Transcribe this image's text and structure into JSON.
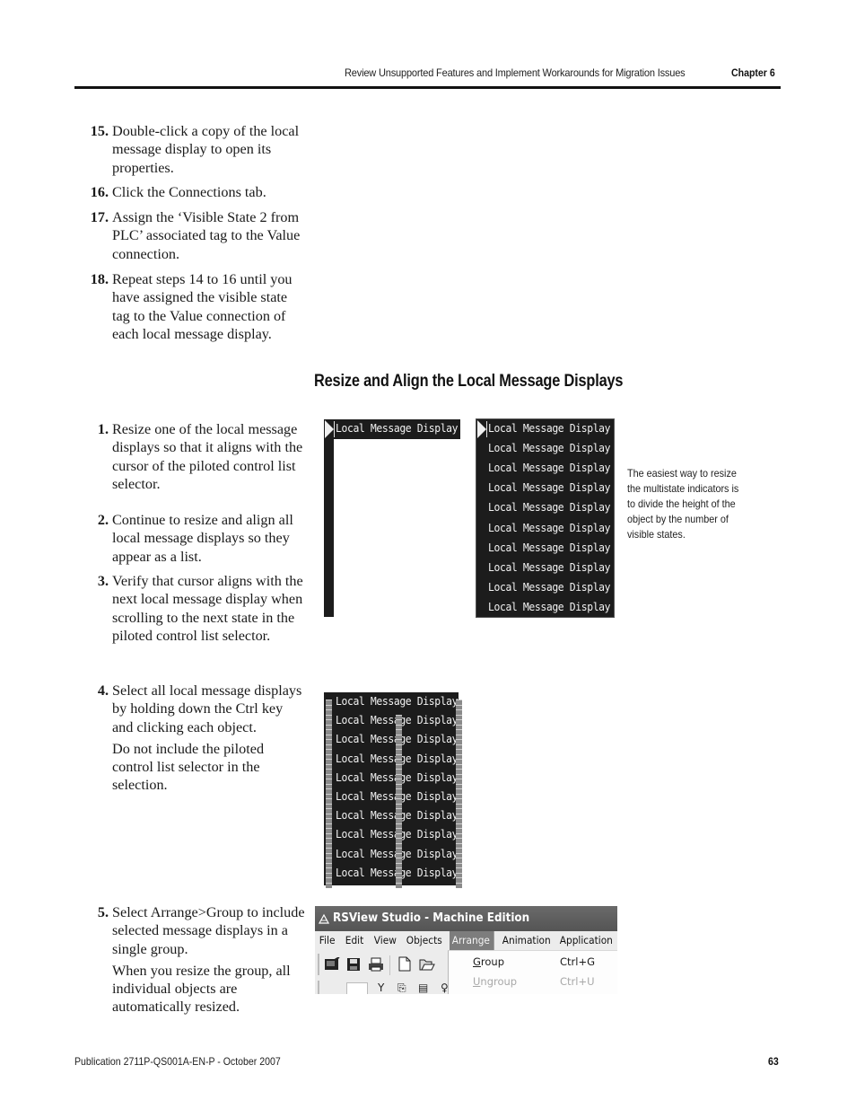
{
  "header": {
    "running_title": "Review Unsupported Features and Implement Workarounds for Migration Issues",
    "chapter": "Chapter 6"
  },
  "steps_part1": [
    {
      "number": "15.",
      "text": "Double-click a copy of the local message display to open its properties."
    },
    {
      "number": "16.",
      "text": "Click the Connections tab."
    },
    {
      "number": "17.",
      "text": "Assign the ‘Visible State 2 from PLC’ associated tag to the Value connection."
    },
    {
      "number": "18.",
      "text": "Repeat steps 14 to 16 until you have assigned the visible state tag to the Value connection of each local message display."
    }
  ],
  "section": {
    "title": "Resize and Align the Local Message Displays"
  },
  "steps_part2": [
    {
      "number": "1.",
      "text": "Resize one of the local message displays so that it aligns with the cursor of the piloted control list selector."
    },
    {
      "number": "2.",
      "text": "Continue to resize and align all local message displays so they appear as a list."
    },
    {
      "number": "3.",
      "text": "Verify that cursor aligns with the next local message display when scrolling to the next state in the piloted control list selector."
    },
    {
      "number": "4.",
      "text": "Select all local message displays by holding down the Ctrl key and clicking each object.",
      "note": "Do not include the piloted control list selector in the selection."
    },
    {
      "number": "5.",
      "text": "Select Arrange>Group to include selected message displays in a single group.",
      "note": "When you resize the group, all individual objects are automatically resized."
    }
  ],
  "side_note": "The easiest way to resize the multistate indicators is to divide the height of the object by the number of visible states.",
  "figures": {
    "display_label": "Local Message Display",
    "list_rows": [
      "Local Message Display",
      "Local Message Display",
      "Local Message Display",
      "Local Message Display",
      "Local Message Display",
      "Local Message Display",
      "Local Message Display",
      "Local Message Display",
      "Local Message Display",
      "Local Message Display"
    ],
    "selected_rows": [
      "Local Message Display",
      "Local Message Display",
      "Local Message Display",
      "Local Message Display",
      "Local Message Display",
      "Local Message Display",
      "Local Message Display",
      "Local Message Display",
      "Local Message Display",
      "Local Message Display"
    ]
  },
  "rsview": {
    "title": "RSView Studio - Machine Edition",
    "menu": [
      "File",
      "Edit",
      "View",
      "Objects",
      "Arrange",
      "Animation",
      "Application"
    ],
    "active_menu": "Arrange",
    "dropdown": [
      {
        "label": "Group",
        "mnemonic": "G",
        "rest": "roup",
        "accel": "Ctrl+G",
        "enabled": true
      },
      {
        "label": "Ungroup",
        "mnemonic": "U",
        "rest": "ngroup",
        "accel": "Ctrl+U",
        "enabled": false
      }
    ],
    "toolbar_icons": [
      "project-icon",
      "save-icon",
      "print-icon",
      "new-icon",
      "open-icon"
    ]
  },
  "footer": {
    "publication": "Publication 2711P-QS001A-EN-P - October 2007",
    "page_number": "63"
  }
}
